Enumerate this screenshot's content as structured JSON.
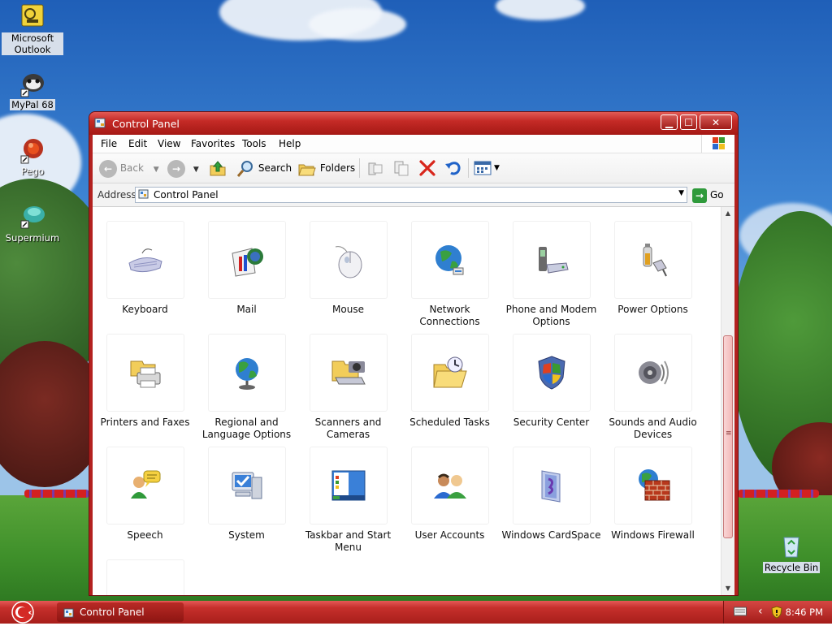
{
  "desktop": {
    "icons": [
      {
        "label": "Microsoft Outlook"
      },
      {
        "label": "MyPal 68"
      },
      {
        "label": "Pego"
      },
      {
        "label": "Supermium"
      },
      {
        "label": "Recycle Bin"
      }
    ]
  },
  "window": {
    "title": "Control Panel",
    "menu": [
      "File",
      "Edit",
      "View",
      "Favorites",
      "Tools",
      "Help"
    ],
    "toolbar": {
      "back": "Back",
      "search": "Search",
      "folders": "Folders"
    },
    "address": {
      "label": "Address",
      "value": "Control Panel",
      "go": "Go"
    },
    "items": [
      {
        "label": "Keyboard",
        "icon": "keyboard-icon"
      },
      {
        "label": "Mail",
        "icon": "mail-icon"
      },
      {
        "label": "Mouse",
        "icon": "mouse-icon"
      },
      {
        "label": "Network Connections",
        "icon": "network-icon"
      },
      {
        "label": "Phone and Modem Options",
        "icon": "phone-modem-icon"
      },
      {
        "label": "Power Options",
        "icon": "power-icon"
      },
      {
        "label": "Printers and Faxes",
        "icon": "printer-icon"
      },
      {
        "label": "Regional and Language Options",
        "icon": "globe-icon"
      },
      {
        "label": "Scanners and Cameras",
        "icon": "scanner-icon"
      },
      {
        "label": "Scheduled Tasks",
        "icon": "scheduled-tasks-icon"
      },
      {
        "label": "Security Center",
        "icon": "shield-icon"
      },
      {
        "label": "Sounds and Audio Devices",
        "icon": "speaker-icon"
      },
      {
        "label": "Speech",
        "icon": "speech-icon"
      },
      {
        "label": "System",
        "icon": "system-icon"
      },
      {
        "label": "Taskbar and Start Menu",
        "icon": "taskbar-icon"
      },
      {
        "label": "User Accounts",
        "icon": "users-icon"
      },
      {
        "label": "Windows CardSpace",
        "icon": "cardspace-icon"
      },
      {
        "label": "Windows Firewall",
        "icon": "firewall-icon"
      },
      {
        "label": "",
        "icon": "wireless-icon"
      }
    ]
  },
  "taskbar": {
    "task": "Control Panel",
    "clock": "8:46 PM"
  }
}
